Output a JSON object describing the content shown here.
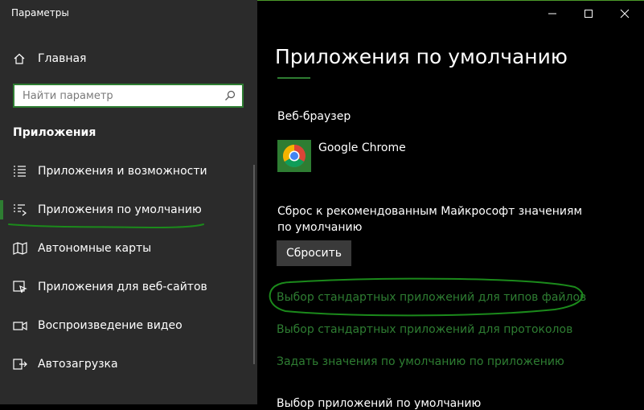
{
  "window": {
    "title": "Параметры",
    "controls": {
      "minimize": "minimize-icon",
      "maximize": "maximize-icon",
      "close": "close-icon"
    }
  },
  "sidebar": {
    "home_label": "Главная",
    "search": {
      "placeholder": "Найти параметр",
      "value": ""
    },
    "section_title": "Приложения",
    "items": [
      {
        "label": "Приложения и возможности",
        "icon": "apps-list-icon",
        "selected": false
      },
      {
        "label": "Приложения по умолчанию",
        "icon": "default-apps-icon",
        "selected": true
      },
      {
        "label": "Автономные карты",
        "icon": "map-icon",
        "selected": false
      },
      {
        "label": "Приложения для веб-сайтов",
        "icon": "web-apps-icon",
        "selected": false
      },
      {
        "label": "Воспроизведение видео",
        "icon": "video-icon",
        "selected": false
      },
      {
        "label": "Автозагрузка",
        "icon": "startup-icon",
        "selected": false
      }
    ]
  },
  "main": {
    "title": "Приложения по умолчанию",
    "browser_label": "Веб-браузер",
    "browser_app": "Google Chrome",
    "reset_description": "Сброс к рекомендованным Майкрософт значениям по умолчанию",
    "reset_button": "Сбросить",
    "links": [
      "Выбор стандартных приложений для типов файлов",
      "Выбор стандартных приложений для протоколов",
      "Задать значения по умолчанию по приложению"
    ],
    "cut_off_text": "Выбор приложений по умолчанию"
  },
  "colors": {
    "accent": "#2e7d32",
    "sidebar_bg": "#2b2b2b",
    "main_bg": "#000000",
    "button_bg": "#3a3a3a",
    "annotation": "#1b8a1b"
  }
}
